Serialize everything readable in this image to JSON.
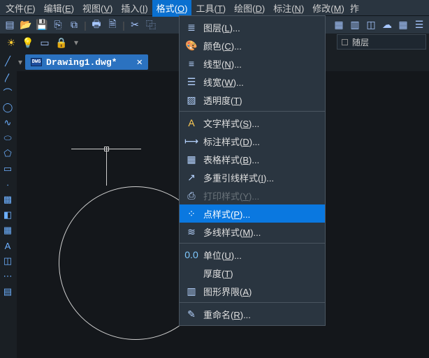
{
  "menu": {
    "file": "文件(<u>F</u>)",
    "edit": "编辑(<u>E</u>)",
    "view": "视图(<u>V</u>)",
    "insert": "插入(<u>I</u>)",
    "format": "格式(<u>O</u>)",
    "tools": "工具(<u>T</u>)",
    "draw": "绘图(<u>D</u>)",
    "annotate": "标注(<u>N</u>)",
    "modify": "修改(<u>M</u>)",
    "trunc": "拃"
  },
  "layer": {
    "label": "随层"
  },
  "tab": {
    "name": "Drawing1.dwg*",
    "icon": "DWG"
  },
  "dd": {
    "layer": "图层(<u>L</u>)...",
    "color": "颜色(<u>C</u>)...",
    "linetype": "线型(<u>N</u>)...",
    "lineweight": "线宽(<u>W</u>)...",
    "transparency": "透明度(<u>T</u>)",
    "textstyle": "文字样式(<u>S</u>)...",
    "dimstyle": "标注样式(<u>D</u>)...",
    "tablestyle": "表格样式(<u>B</u>)...",
    "mleaderstyle": "多重引线样式(<u>I</u>)...",
    "plotstyle": "打印样式(<u>Y</u>)...",
    "pointstyle": "点样式(<u>P</u>)...",
    "mlinestyle": "多线样式(<u>M</u>)...",
    "units": "单位(<u>U</u>)...",
    "thickness": "厚度(<u>T</u>)",
    "limits": "图形界限(<u>A</u>)",
    "rename": "重命名(<u>R</u>)..."
  }
}
